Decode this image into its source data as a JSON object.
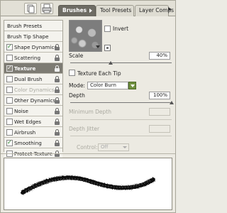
{
  "tabs": [
    {
      "label": "Brushes",
      "active": true
    },
    {
      "label": "Tool Presets",
      "active": false
    },
    {
      "label": "Layer Comps",
      "active": false
    }
  ],
  "icons": {
    "documents": "documents-icon",
    "printer": "printer-icon",
    "panel_menu": "panel-menu-arrow-icon",
    "lock": "lock-icon",
    "new_preset": "new-preset-icon"
  },
  "sidebar": {
    "header1": "Brush Presets",
    "header2": "Brush Tip Shape",
    "items": [
      {
        "label": "Shape Dynamics",
        "checked": true,
        "selected": false,
        "dim": false
      },
      {
        "label": "Scattering",
        "checked": false,
        "selected": false,
        "dim": false
      },
      {
        "label": "Texture",
        "checked": true,
        "selected": true,
        "dim": false
      },
      {
        "label": "Dual Brush",
        "checked": false,
        "selected": false,
        "dim": false
      },
      {
        "label": "Color Dynamics",
        "checked": false,
        "selected": false,
        "dim": true
      },
      {
        "label": "Other Dynamics",
        "checked": false,
        "selected": false,
        "dim": false
      },
      {
        "label": "Noise",
        "checked": false,
        "selected": false,
        "dim": false
      },
      {
        "label": "Wet Edges",
        "checked": false,
        "selected": false,
        "dim": false
      },
      {
        "label": "Airbrush",
        "checked": false,
        "selected": false,
        "dim": false
      },
      {
        "label": "Smoothing",
        "checked": true,
        "selected": false,
        "dim": false
      },
      {
        "label": "Protect Texture",
        "checked": false,
        "selected": false,
        "dim": false
      }
    ]
  },
  "texture": {
    "invert_label": "Invert",
    "invert_checked": false,
    "scale_label": "Scale",
    "scale_value": "40%",
    "scale_level": 0.4,
    "each_tip_label": "Texture Each Tip",
    "each_tip_checked": false,
    "mode_label": "Mode:",
    "mode_value": "Color Burn",
    "depth_label": "Depth",
    "depth_value": "100%",
    "depth_level": 1.0,
    "min_depth_label": "Minimum Depth",
    "depth_jitter_label": "Depth Jitter",
    "control_label": "Control:",
    "control_value": "Off"
  }
}
